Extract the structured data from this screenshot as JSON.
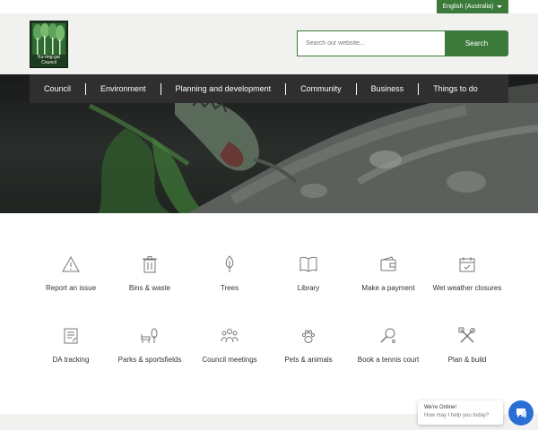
{
  "language": {
    "selected": "English (Australia)",
    "caret_icon": "chevron-down-icon"
  },
  "logo": {
    "line1": "Ku-ring-gai",
    "line2": "Council"
  },
  "search": {
    "placeholder": "Search our website...",
    "button_label": "Search"
  },
  "nav": {
    "items": [
      {
        "label": "Council"
      },
      {
        "label": "Environment"
      },
      {
        "label": "Planning and development"
      },
      {
        "label": "Community"
      },
      {
        "label": "Business"
      },
      {
        "label": "Things to do"
      }
    ]
  },
  "quick_links": [
    {
      "label": "Report an issue",
      "icon": "warning-icon"
    },
    {
      "label": "Bins & waste",
      "icon": "bin-icon"
    },
    {
      "label": "Trees",
      "icon": "tree-icon"
    },
    {
      "label": "Library",
      "icon": "book-icon"
    },
    {
      "label": "Make a payment",
      "icon": "wallet-icon"
    },
    {
      "label": "Wet weather closures",
      "icon": "calendar-icon"
    },
    {
      "label": "DA tracking",
      "icon": "document-icon"
    },
    {
      "label": "Parks & sportsfields",
      "icon": "park-icon"
    },
    {
      "label": "Council meetings",
      "icon": "people-icon"
    },
    {
      "label": "Pets & animals",
      "icon": "paw-icon"
    },
    {
      "label": "Book a tennis court",
      "icon": "tennis-icon"
    },
    {
      "label": "Plan & build",
      "icon": "tools-icon"
    }
  ],
  "chat": {
    "status": "We're Online!",
    "prompt": "How may I help you today?",
    "icon": "chat-icon"
  },
  "colors": {
    "brand_green": "#3b7a3a",
    "nav_bg": "#2f2f2f",
    "chat_blue": "#2a6fd6"
  }
}
